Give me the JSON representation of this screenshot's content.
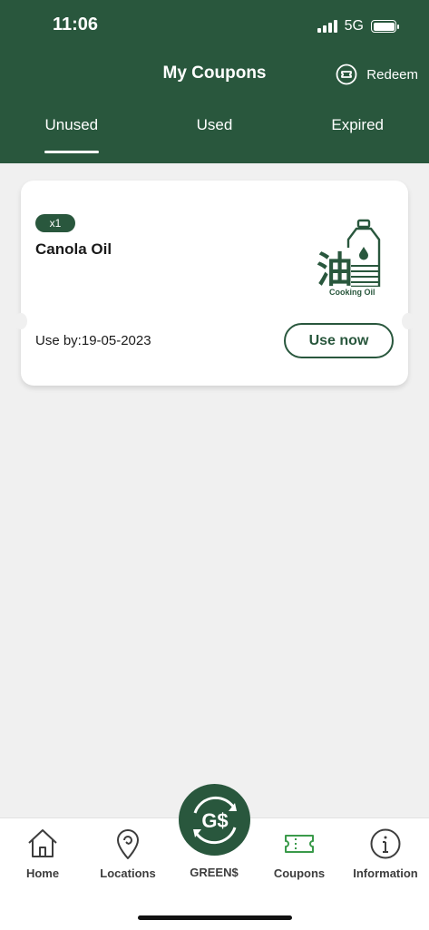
{
  "status_bar": {
    "time": "11:06",
    "network": "5G"
  },
  "header": {
    "title": "My Coupons",
    "redeem_label": "Redeem"
  },
  "tabs": [
    {
      "label": "Unused",
      "active": true
    },
    {
      "label": "Used",
      "active": false
    },
    {
      "label": "Expired",
      "active": false
    }
  ],
  "coupon": {
    "quantity": "x1",
    "title": "Canola Oil",
    "image_caption": "Cooking Oil",
    "image_glyph": "油",
    "use_by": "Use by:19-05-2023",
    "action_label": "Use now"
  },
  "bottom_nav": {
    "items": [
      {
        "label": "Home",
        "icon": "home-icon"
      },
      {
        "label": "Locations",
        "icon": "location-pin-icon"
      },
      {
        "label": "GREEN$",
        "icon": "green-dollar-icon"
      },
      {
        "label": "Coupons",
        "icon": "coupon-icon"
      },
      {
        "label": "Information",
        "icon": "info-icon"
      }
    ],
    "center_glyph": "G$"
  },
  "colors": {
    "brand": "#29573d",
    "active_nav": "#3a9a4a",
    "background": "#f0f0f0"
  }
}
